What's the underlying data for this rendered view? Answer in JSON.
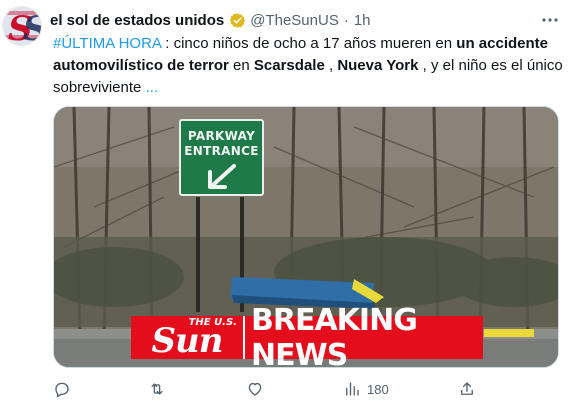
{
  "author": {
    "name": "el sol de estados unidos",
    "handle": "@TheSunUS",
    "separator": "·",
    "time": "1h"
  },
  "tweet": {
    "hashtag": "#ÚLTIMA HORA",
    "t1": " : cinco niños de ocho a 17 años mueren en ",
    "b1": "un accidente automovilístico de terror",
    "t2": " en ",
    "b2": "Scarsdale",
    "t3": " , ",
    "b3": "Nueva York",
    "t4": " , y el niño es el único sobreviviente ",
    "more": "..."
  },
  "media": {
    "sign_line1": "PARKWAY",
    "sign_line2": "ENTRANCE",
    "logo_the": "THE U.S.",
    "logo_word": "Sun",
    "banner": "BREAKING NEWS"
  },
  "actions": {
    "views_count": "180"
  },
  "colors": {
    "accent": "#1d9bf0",
    "verified_gold": "#e2b719",
    "sun_red": "#e40d1b",
    "sign_green": "#1f7a4a"
  }
}
